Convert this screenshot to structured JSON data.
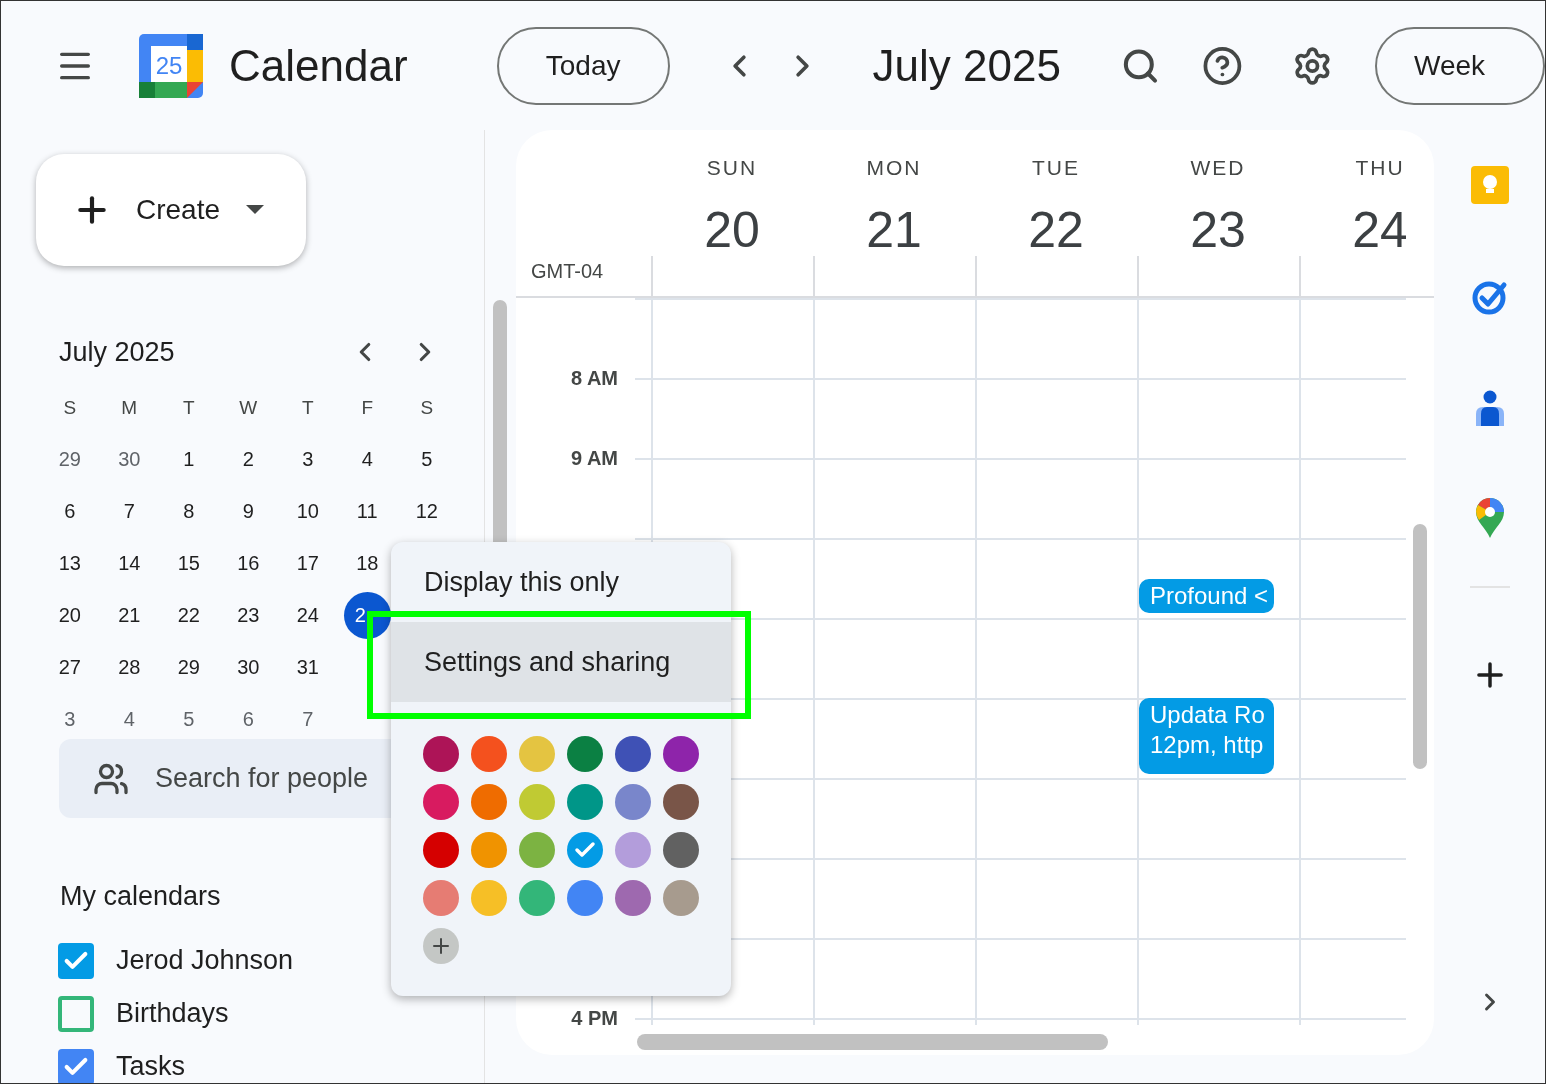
{
  "header": {
    "logo_text": "25",
    "app_name": "Calendar",
    "today_button": "Today",
    "period": "July 2025",
    "view_button": "Week"
  },
  "create_button": "Create",
  "mini_calendar": {
    "title": "July 2025",
    "weekdays": [
      "S",
      "M",
      "T",
      "W",
      "T",
      "F",
      "S"
    ],
    "weeks": [
      [
        {
          "d": "29",
          "dim": true,
          "selected": false
        },
        {
          "d": "30",
          "dim": true,
          "selected": false
        },
        {
          "d": "1",
          "dim": false,
          "selected": false
        },
        {
          "d": "2",
          "dim": false,
          "selected": false
        },
        {
          "d": "3",
          "dim": false,
          "selected": false
        },
        {
          "d": "4",
          "dim": false,
          "selected": false
        },
        {
          "d": "5",
          "dim": false,
          "selected": false
        }
      ],
      [
        {
          "d": "6",
          "dim": false,
          "selected": false
        },
        {
          "d": "7",
          "dim": false,
          "selected": false
        },
        {
          "d": "8",
          "dim": false,
          "selected": false
        },
        {
          "d": "9",
          "dim": false,
          "selected": false
        },
        {
          "d": "10",
          "dim": false,
          "selected": false
        },
        {
          "d": "11",
          "dim": false,
          "selected": false
        },
        {
          "d": "12",
          "dim": false,
          "selected": false
        }
      ],
      [
        {
          "d": "13",
          "dim": false,
          "selected": false
        },
        {
          "d": "14",
          "dim": false,
          "selected": false
        },
        {
          "d": "15",
          "dim": false,
          "selected": false
        },
        {
          "d": "16",
          "dim": false,
          "selected": false
        },
        {
          "d": "17",
          "dim": false,
          "selected": false
        },
        {
          "d": "18",
          "dim": false,
          "selected": false
        }
      ],
      [
        {
          "d": "20",
          "dim": false,
          "selected": false
        },
        {
          "d": "21",
          "dim": false,
          "selected": false
        },
        {
          "d": "22",
          "dim": false,
          "selected": false
        },
        {
          "d": "23",
          "dim": false,
          "selected": false
        },
        {
          "d": "24",
          "dim": false,
          "selected": false
        },
        {
          "d": "2",
          "dim": false,
          "selected": true
        }
      ],
      [
        {
          "d": "27",
          "dim": false,
          "selected": false
        },
        {
          "d": "28",
          "dim": false,
          "selected": false
        },
        {
          "d": "29",
          "dim": false,
          "selected": false
        },
        {
          "d": "30",
          "dim": false,
          "selected": false
        },
        {
          "d": "31",
          "dim": false,
          "selected": false
        }
      ],
      [
        {
          "d": "3",
          "dim": true,
          "selected": false
        },
        {
          "d": "4",
          "dim": true,
          "selected": false
        },
        {
          "d": "5",
          "dim": true,
          "selected": false
        },
        {
          "d": "6",
          "dim": true,
          "selected": false
        },
        {
          "d": "7",
          "dim": true,
          "selected": false
        }
      ]
    ]
  },
  "people_search": {
    "placeholder": "Search for people"
  },
  "my_calendars": {
    "title": "My calendars",
    "items": [
      {
        "name": "Jerod Johnson",
        "checked": true,
        "color": "#039be5"
      },
      {
        "name": "Birthdays",
        "checked": false,
        "color": "#33b679"
      },
      {
        "name": "Tasks",
        "checked": true,
        "color": "#4285f4"
      }
    ]
  },
  "week": {
    "timezone": "GMT-04",
    "days": [
      {
        "name": "SUN",
        "date": "20"
      },
      {
        "name": "MON",
        "date": "21"
      },
      {
        "name": "TUE",
        "date": "22"
      },
      {
        "name": "WED",
        "date": "23",
        "events": [
          {
            "title": "Profound <",
            "color": "#039be5"
          },
          {
            "title": "Updata Ro",
            "detail": "12pm, http",
            "color": "#039be5"
          }
        ]
      },
      {
        "name": "THU",
        "date": "24"
      }
    ],
    "hours_top": [
      "8 AM",
      "9 AM"
    ],
    "hours_bottom": [
      "4 PM"
    ]
  },
  "context_menu": {
    "items": [
      {
        "label": "Display this only",
        "selected": false,
        "outlined": false
      },
      {
        "label": "Settings and sharing",
        "selected": true,
        "outlined": true
      }
    ],
    "swatches": [
      {
        "color": "#ad1457",
        "selected": false
      },
      {
        "color": "#f4511e",
        "selected": false
      },
      {
        "color": "#e4c441",
        "selected": false
      },
      {
        "color": "#0b8043",
        "selected": false
      },
      {
        "color": "#3f51b5",
        "selected": false
      },
      {
        "color": "#8e24aa",
        "selected": false
      },
      {
        "color": "#d81b60",
        "selected": false
      },
      {
        "color": "#ef6c00",
        "selected": false
      },
      {
        "color": "#c0ca33",
        "selected": false
      },
      {
        "color": "#009688",
        "selected": false
      },
      {
        "color": "#7986cb",
        "selected": false
      },
      {
        "color": "#795548",
        "selected": false
      },
      {
        "color": "#d50000",
        "selected": false
      },
      {
        "color": "#f09300",
        "selected": false
      },
      {
        "color": "#7cb342",
        "selected": false
      },
      {
        "color": "#039be5",
        "selected": true
      },
      {
        "color": "#b39ddb",
        "selected": false
      },
      {
        "color": "#616161",
        "selected": false
      },
      {
        "color": "#e67c73",
        "selected": false
      },
      {
        "color": "#f6bf26",
        "selected": false
      },
      {
        "color": "#33b679",
        "selected": false
      },
      {
        "color": "#4285f4",
        "selected": false
      },
      {
        "color": "#9e69af",
        "selected": false
      },
      {
        "color": "#a79b8e",
        "selected": false
      }
    ]
  }
}
